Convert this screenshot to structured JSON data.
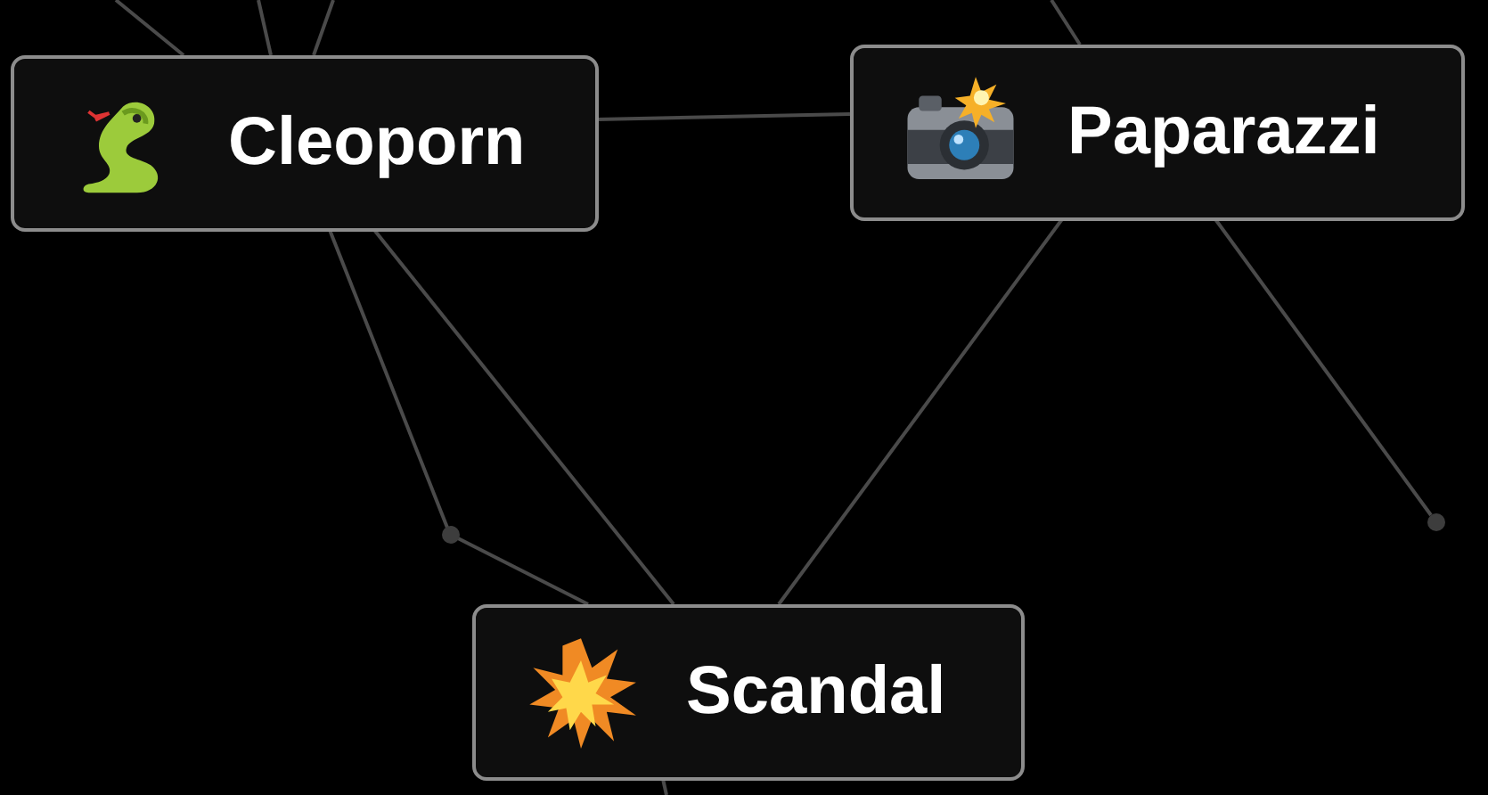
{
  "canvas": {
    "elements": [
      {
        "label": "Cleoporn"
      },
      {
        "label": "Paparazzi"
      },
      {
        "label": "Scandal"
      }
    ]
  }
}
